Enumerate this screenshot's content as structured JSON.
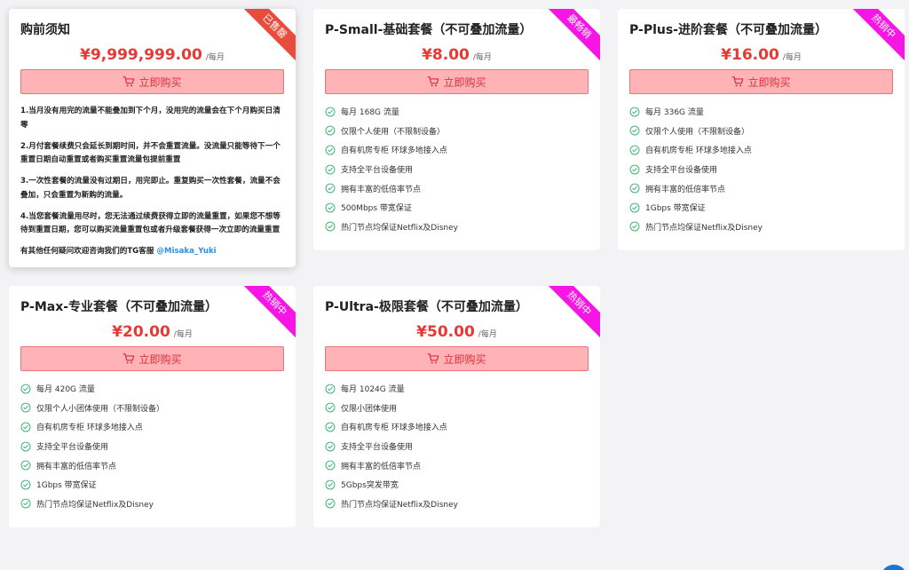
{
  "notice_card": {
    "title": "购前须知",
    "ribbon": "已售罄",
    "price": "¥9,999,999.00",
    "unit": "/每月",
    "buy_label": "立即购买",
    "notes": [
      "1.当月没有用完的流量不能叠加到下个月，没用完的流量会在下个月购买日清零",
      "2.月付套餐续费只会延长到期时间，并不会重置流量。没流量只能等待下一个重置日期自动重置或者购买重置流量包提前重置",
      "3.一次性套餐的流量没有过期日，用完即止。重复购买一次性套餐，流量不会叠加，只会重置为新购的流量。",
      "4.当您套餐流量用尽时，您无法通过续费获得立即的流量重置，如果您不想等待到重置日期，您可以购买流量重置包或者升级套餐获得一次立即的流量重置"
    ],
    "contact_text": "有其他任何疑问欢迎咨询我们的TG客服 ",
    "contact_handle": "@Misaka_Yuki"
  },
  "plans": [
    {
      "title": "P-Small-基础套餐（不可叠加流量）",
      "ribbon": "最畅销",
      "price": "¥8.00",
      "unit": "/每月",
      "buy_label": "立即购买",
      "features": [
        "每月 168G 流量",
        "仅限个人使用（不限制设备）",
        "自有机房专柜 环球多地接入点",
        "支持全平台设备使用",
        "拥有丰富的低倍率节点",
        "500Mbps 带宽保证",
        "热门节点均保证Netflix及Disney"
      ]
    },
    {
      "title": "P-Plus-进阶套餐（不可叠加流量）",
      "ribbon": "热销中",
      "price": "¥16.00",
      "unit": "/每月",
      "buy_label": "立即购买",
      "features": [
        "每月 336G 流量",
        "仅限个人使用（不限制设备）",
        "自有机房专柜 环球多地接入点",
        "支持全平台设备使用",
        "拥有丰富的低倍率节点",
        "1Gbps 带宽保证",
        "热门节点均保证Netflix及Disney"
      ]
    },
    {
      "title": "P-Max-专业套餐（不可叠加流量）",
      "ribbon": "热销中",
      "price": "¥20.00",
      "unit": "/每月",
      "buy_label": "立即购买",
      "features": [
        "每月 420G 流量",
        "仅限个人小团体使用（不限制设备）",
        "自有机房专柜 环球多地接入点",
        "支持全平台设备使用",
        "拥有丰富的低倍率节点",
        "1Gbps 带宽保证",
        "热门节点均保证Netflix及Disney"
      ]
    },
    {
      "title": "P-Ultra-极限套餐（不可叠加流量）",
      "ribbon": "热销中",
      "price": "¥50.00",
      "unit": "/每月",
      "buy_label": "立即购买",
      "features": [
        "每月 1024G 流量",
        "仅限小团体使用",
        "自有机房专柜 环球多地接入点",
        "支持全平台设备使用",
        "拥有丰富的低倍率节点",
        "5Gbps突发带宽",
        "热门节点均保证Netflix及Disney"
      ]
    }
  ],
  "colors": {
    "accent": "#e53935",
    "ribbon_sold_out": "#e74c3c",
    "ribbon_hot": "#f515e4",
    "check": "#3cb371",
    "button_bg": "#ffb3b7"
  },
  "icons": {
    "buy": "cart-icon",
    "feature": "check-circle-icon"
  }
}
